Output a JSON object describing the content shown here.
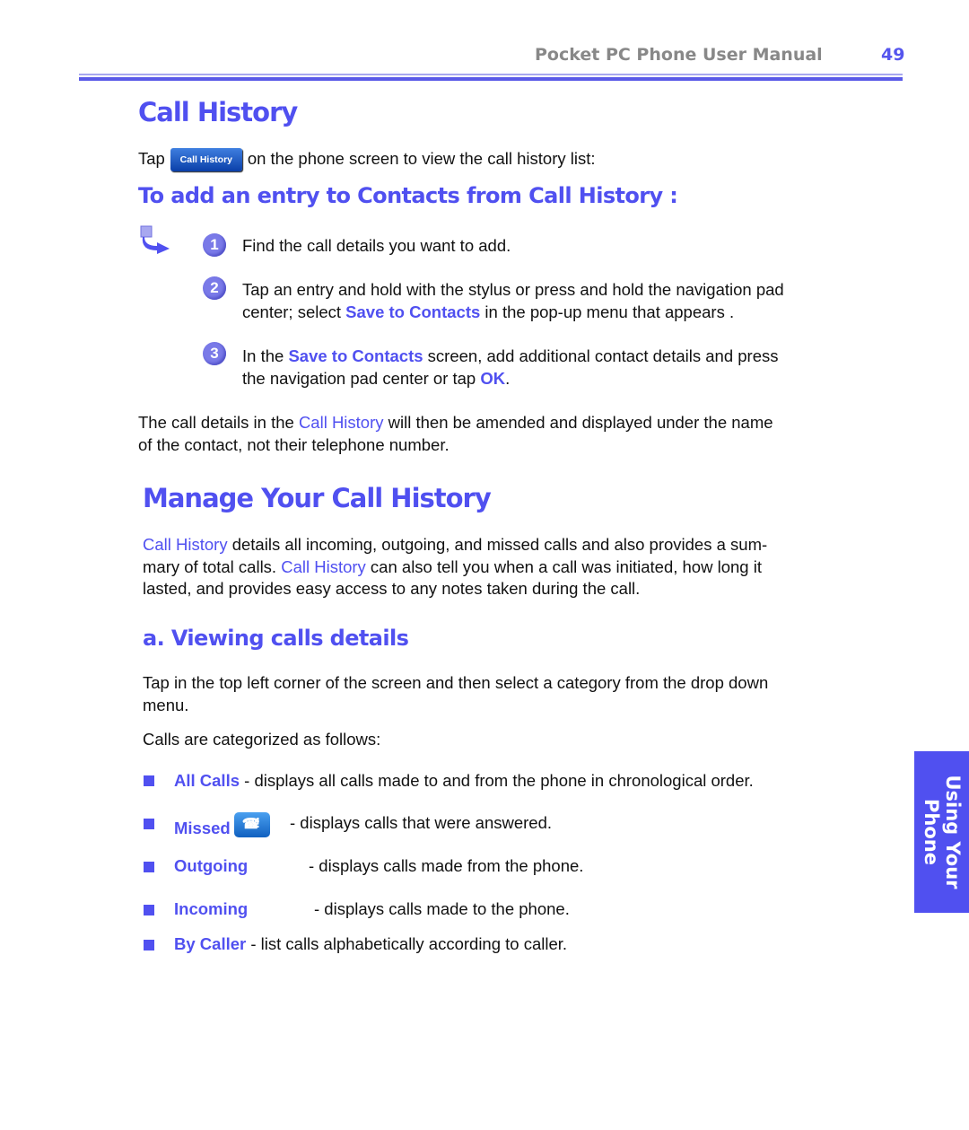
{
  "header": {
    "manual_title": "Pocket PC Phone User Manual",
    "page_number": "49"
  },
  "section1": {
    "title": "Call History",
    "intro_before": "Tap",
    "button_label": "Call History",
    "intro_after": "on the phone screen to view the call history list:",
    "subtitle": "To add an entry to Contacts from Call History :",
    "steps": [
      {
        "num": "1",
        "text": "Find the call details you want to add."
      },
      {
        "num": "2",
        "line1": "Tap an entry and hold with the stylus or press and hold the navigation pad",
        "line2_pre": "center; select ",
        "line2_hl": "Save to Contacts",
        "line2_post": " in the pop-up menu that appears ."
      },
      {
        "num": "3",
        "line1_pre": "In the ",
        "line1_hl": "Save to Contacts",
        "line1_post": " screen, add additional contact details and press",
        "line2_pre": "the navigation pad center or tap ",
        "line2_hl": "OK",
        "line2_post": "."
      }
    ],
    "closing_pre": "The call details in the ",
    "closing_hl": "Call History",
    "closing_post": " will then be amended and displayed under the name",
    "closing_line2": "of the contact, not their telephone number."
  },
  "section2": {
    "title": "Manage Your Call History",
    "p1_hl1": "Call History",
    "p1_a": " details all incoming, outgoing, and missed calls and also provides a sum-",
    "p1_b": "mary of total calls.  ",
    "p1_hl2": "Call History",
    "p1_c": " can also tell you when a call was initiated, how long it",
    "p1_d": "lasted, and provides easy access to any notes taken during the call.",
    "subtitle": "a.  Viewing calls details",
    "p2_line1": "Tap in the top left corner of the screen and then select a category from the drop down",
    "p2_line2": "menu.",
    "p3": "Calls are categorized as follows:",
    "categories": [
      {
        "name": "All Calls",
        "desc": " - displays all calls made to and from the phone in chronological order."
      },
      {
        "name": "Missed",
        "desc": "- displays calls that were answered."
      },
      {
        "name": "Outgoing",
        "desc": "- displays calls made from the phone."
      },
      {
        "name": "Incoming",
        "desc": "- displays calls made to the phone."
      },
      {
        "name": "By Caller",
        "desc": " - list calls alphabetically according to caller."
      }
    ]
  },
  "side_tab": {
    "line1": "Using Your",
    "line2": "Phone"
  }
}
